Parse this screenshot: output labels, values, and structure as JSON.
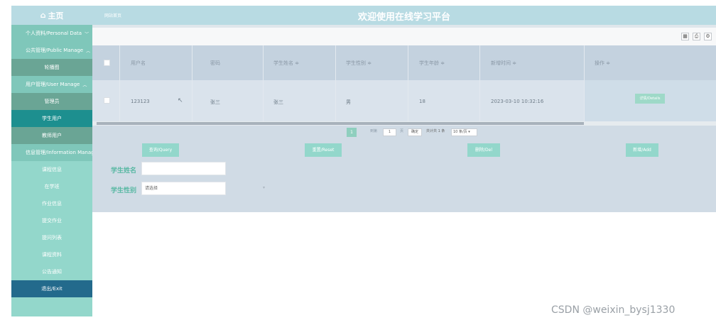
{
  "sidebar": {
    "home": "主页",
    "items": [
      {
        "label": "个人资料/Personal Data",
        "type": "group"
      },
      {
        "label": "公共管理/Public Manage",
        "type": "group"
      },
      {
        "label": "轮播图",
        "type": "sub"
      },
      {
        "label": "用户管理/User Manage",
        "type": "group"
      },
      {
        "label": "管理员",
        "type": "sub"
      },
      {
        "label": "学生用户",
        "type": "sub-active"
      },
      {
        "label": "教师用户",
        "type": "sub"
      },
      {
        "label": "信息管理/Information Manage",
        "type": "group"
      },
      {
        "label": "课程信息",
        "type": "plain"
      },
      {
        "label": "在学班",
        "type": "plain"
      },
      {
        "label": "作业信息",
        "type": "plain"
      },
      {
        "label": "提交作业",
        "type": "plain"
      },
      {
        "label": "提问列表",
        "type": "plain"
      },
      {
        "label": "课程资料",
        "type": "plain"
      },
      {
        "label": "公告通知",
        "type": "plain"
      },
      {
        "label": "退出/Exit",
        "type": "exit"
      }
    ]
  },
  "header": {
    "breadcrumb": "网站首页",
    "title": "欢迎使用在线学习平台"
  },
  "toolbar": {
    "icons": [
      "export-icon",
      "print-icon",
      "settings-icon"
    ]
  },
  "table": {
    "headers": [
      "用户名",
      "密码",
      "学生姓名 ≑",
      "学生性别 ≑",
      "学生年龄 ≑",
      "新增时间 ≑",
      "操作 ≑"
    ],
    "rows": [
      {
        "username": "123123",
        "password": "张三",
        "name": "张三",
        "gender": "男",
        "age": "18",
        "created": "2023-03-10 10:32:16",
        "action": "详情/Details"
      }
    ]
  },
  "pagination": {
    "current": "1",
    "goto_label": "到第",
    "goto_value": "1",
    "page_unit": "页",
    "confirm": "确定",
    "total": "共计共 1 条",
    "page_size": "10 条/页"
  },
  "actions": {
    "query": "查询/Query",
    "reset": "重置/Reset",
    "delete": "删除/Del",
    "add": "新增/Add"
  },
  "filters": {
    "name_label": "学生姓名",
    "name_value": "",
    "gender_label": "学生性别",
    "gender_placeholder": "请选择"
  },
  "watermark": "CSDN @weixin_bysj1330",
  "colors": {
    "sidebar": "#93d7cb",
    "header": "#b8dbe3",
    "accent": "#1d8f8f",
    "exit": "#236a8c"
  }
}
